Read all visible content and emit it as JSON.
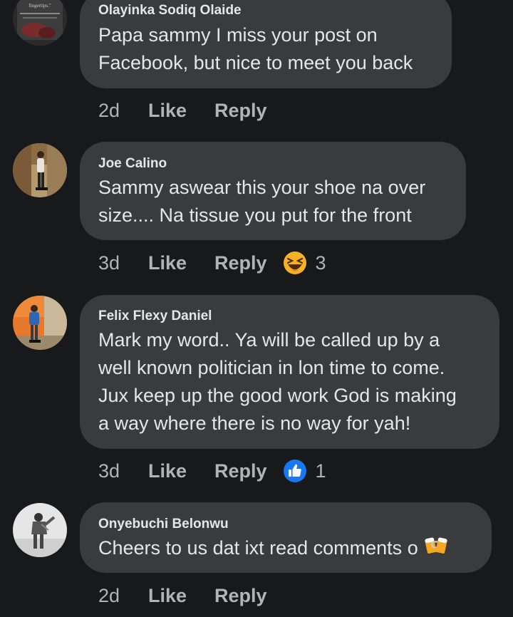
{
  "comments": [
    {
      "author": "Olayinka Sodiq Olaide",
      "lines": [
        "Papa sammy I miss your post on",
        "Facebook, but nice to meet you back"
      ],
      "time": "2d",
      "like_label": "Like",
      "reply_label": "Reply",
      "avatar_text": "fingertips.\""
    },
    {
      "author": "Joe Calino",
      "lines": [
        "Sammy aswear this your shoe na over",
        "size.... Na tissue you put for the front"
      ],
      "time": "3d",
      "like_label": "Like",
      "reply_label": "Reply",
      "reaction": {
        "icon": "haha-reaction-icon",
        "count": "3"
      }
    },
    {
      "author": "Felix Flexy Daniel",
      "lines": [
        "Mark my word.. Ya will be called up by a",
        "well known politician in lon time to come.",
        "Jux keep up the good work God is making",
        "a way where there is no way for yah!"
      ],
      "time": "3d",
      "like_label": "Like",
      "reply_label": "Reply",
      "reaction": {
        "icon": "like-reaction-icon",
        "count": "1"
      }
    },
    {
      "author": "Onyebuchi Belonwu",
      "lines": [
        "Cheers to us dat ixt read comments o"
      ],
      "time": "2d",
      "like_label": "Like",
      "reply_label": "Reply",
      "emoji": "clinking-beer-mugs-emoji"
    }
  ],
  "colors": {
    "background": "#18191a",
    "bubble": "#3a3b3c",
    "text": "#e4e6eb",
    "secondary": "#b0b3b8",
    "like_blue": "#1877f2",
    "haha_yellow": "#f7b125"
  }
}
